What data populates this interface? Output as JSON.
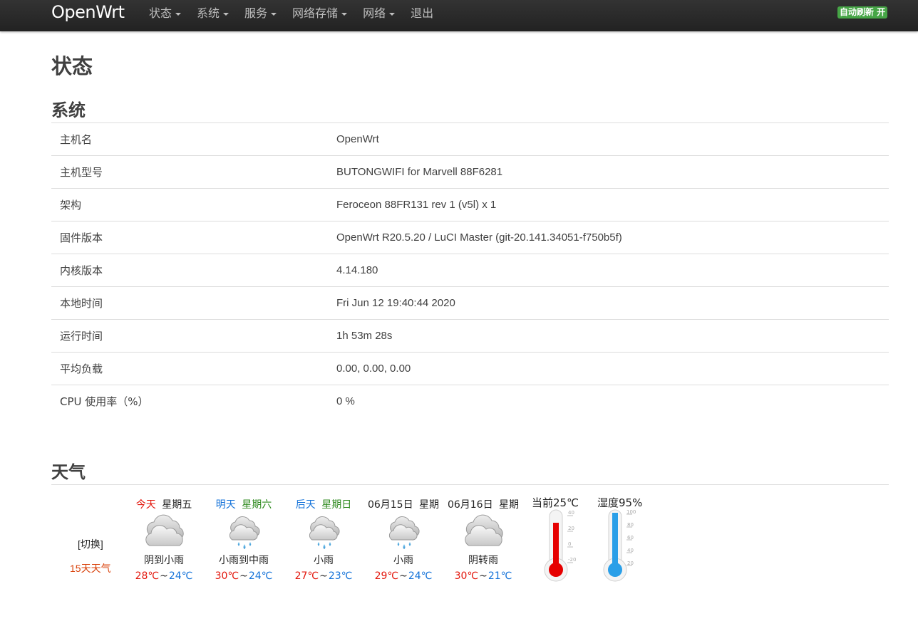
{
  "navbar": {
    "brand": "OpenWrt",
    "items": [
      {
        "label": "状态",
        "dropdown": true
      },
      {
        "label": "系统",
        "dropdown": true
      },
      {
        "label": "服务",
        "dropdown": true
      },
      {
        "label": "网络存储",
        "dropdown": true
      },
      {
        "label": "网络",
        "dropdown": true
      },
      {
        "label": "退出",
        "dropdown": false
      }
    ],
    "auto_refresh": "自动刷新 开",
    "auto_refresh_color": "#46a546"
  },
  "page_title": "状态",
  "system": {
    "title": "系统",
    "rows": [
      {
        "key": "主机名",
        "value": "OpenWrt"
      },
      {
        "key": "主机型号",
        "value": "BUTONGWIFI for Marvell 88F6281"
      },
      {
        "key": "架构",
        "value": "Feroceon 88FR131 rev 1 (v5l) x 1"
      },
      {
        "key": "固件版本",
        "value": "OpenWrt R20.5.20 / LuCI Master (git-20.141.34051-f750b5f)"
      },
      {
        "key": "内核版本",
        "value": "4.14.180"
      },
      {
        "key": "本地时间",
        "value": "Fri Jun 12 19:40:44 2020"
      },
      {
        "key": "运行时间",
        "value": "1h 53m 28s"
      },
      {
        "key": "平均负载",
        "value": "0.00, 0.00, 0.00"
      },
      {
        "key": "CPU 使用率（%）",
        "value": "0 %"
      }
    ]
  },
  "weather": {
    "title": "天气",
    "switch_label": "[切换]",
    "fifteen_day_label": "15天天气",
    "days": [
      {
        "day": "今天",
        "day_color": "red",
        "weekday": "星期五",
        "weekday_color": "dark",
        "icon": "cloudy-icon",
        "desc": "阴到小雨",
        "high": "28℃",
        "low": "24℃"
      },
      {
        "day": "明天",
        "day_color": "blue",
        "weekday": "星期六",
        "weekday_color": "green",
        "icon": "rain-icon",
        "desc": "小雨到中雨",
        "high": "30℃",
        "low": "24℃"
      },
      {
        "day": "后天",
        "day_color": "blue",
        "weekday": "星期日",
        "weekday_color": "green",
        "icon": "rain-icon",
        "desc": "小雨",
        "high": "27℃",
        "low": "23℃"
      },
      {
        "day": "06月15日",
        "day_color": "dark",
        "weekday": "星期",
        "weekday_color": "dark",
        "icon": "rain-icon",
        "desc": "小雨",
        "high": "29℃",
        "low": "24℃"
      },
      {
        "day": "06月16日",
        "day_color": "dark",
        "weekday": "星期",
        "weekday_color": "dark",
        "icon": "cloudy-icon",
        "desc": "阴转雨",
        "high": "30℃",
        "low": "21℃"
      }
    ],
    "separator": "~",
    "current_temp_label": "当前25℃",
    "temp_scale": [
      "40",
      "20",
      "0",
      "-20"
    ],
    "humidity_label": "湿度95%",
    "humidity_scale": [
      "100",
      "80",
      "60",
      "40",
      "20"
    ],
    "temp_color": "#e60000",
    "humidity_color": "#2a9fe8"
  }
}
